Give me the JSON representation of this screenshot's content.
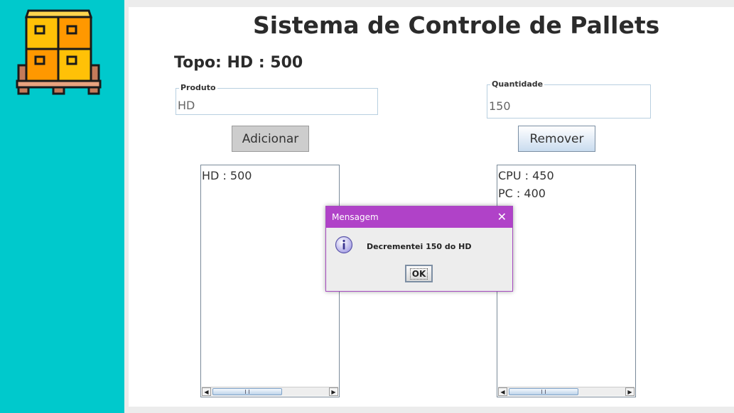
{
  "app": {
    "title": "Sistema de Controle de Pallets",
    "topo_label": "Topo: HD : 500",
    "logo_icon": "pallet-boxes-icon"
  },
  "form": {
    "produto": {
      "label": "Produto",
      "value": "HD"
    },
    "quantidade": {
      "label": "Quantidade",
      "value": "150"
    },
    "add_label": "Adicionar",
    "remove_label": "Remover"
  },
  "lists": {
    "left": {
      "items": [
        "HD : 500"
      ]
    },
    "right": {
      "items": [
        "CPU : 450",
        "PC : 400"
      ]
    }
  },
  "dialog": {
    "title": "Mensagem",
    "message": "Decrementei 150 do HD",
    "ok_label": "OK",
    "icon": "info-icon"
  },
  "colors": {
    "sidebar": "#00c9cc",
    "dialog_titlebar": "#b042c8"
  }
}
